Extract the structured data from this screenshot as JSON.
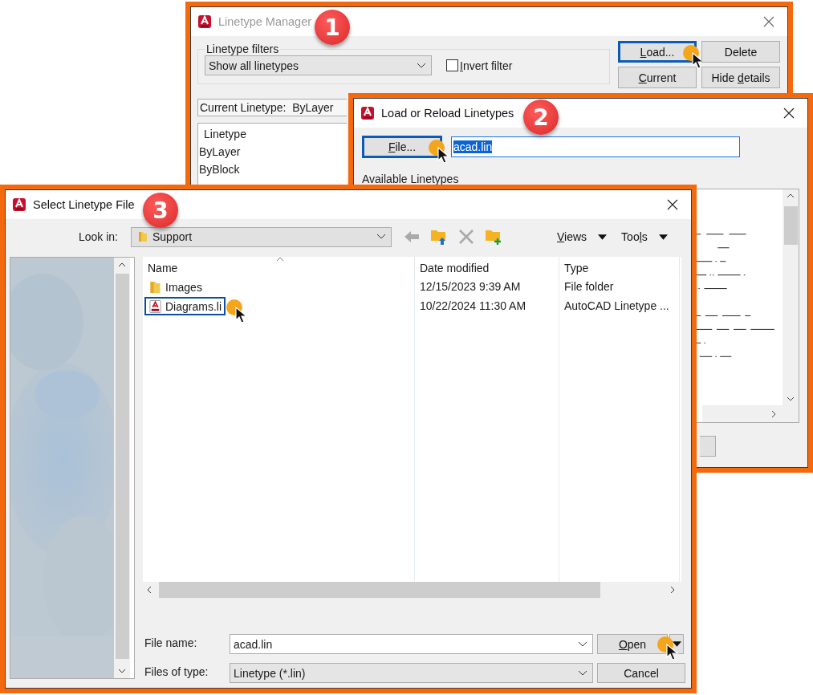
{
  "linetype_manager": {
    "title": "Linetype Manager",
    "active": false,
    "step": "1",
    "filters": {
      "legend": "Linetype filters",
      "combo": "Show all linetypes",
      "invert": {
        "label": "Invert filter",
        "checked": false
      }
    },
    "buttons": [
      {
        "label": "Load...",
        "focused": true,
        "clicked": true
      },
      {
        "label": "Delete",
        "focused": false,
        "clicked": false
      },
      {
        "label": "Current",
        "focused": false,
        "clicked": false
      },
      {
        "label": "Hide details",
        "focused": false,
        "clicked": false
      }
    ],
    "current_linetype": {
      "label": "Current Linetype:",
      "value": "ByLayer"
    },
    "list": {
      "header": "Linetype",
      "items": [
        "ByLayer",
        "ByBlock"
      ]
    }
  },
  "load_dialog": {
    "title": "Load or Reload Linetypes",
    "active": true,
    "step": "2",
    "file_button": {
      "label": "File...",
      "focused": true,
      "clicked": true
    },
    "file_field": {
      "value": "acad.lin",
      "text_selected": true
    },
    "available_label": "Available Linetypes"
  },
  "select_dialog": {
    "title": "Select Linetype File",
    "active": true,
    "step": "3",
    "look_in": {
      "label": "Look in:",
      "folder": "Support"
    },
    "tools": [
      {
        "kind": "back",
        "disabled": true
      },
      {
        "kind": "up",
        "disabled": false
      },
      {
        "kind": "delete",
        "disabled": true
      },
      {
        "kind": "new_folder",
        "disabled": false
      }
    ],
    "menus": [
      {
        "label": "Views"
      },
      {
        "label": "Tools"
      }
    ],
    "columns": [
      "Name",
      "Date modified",
      "Type"
    ],
    "rows": [
      {
        "kind": "folder",
        "name": "Images",
        "date": "12/15/2023 9:39 AM",
        "type": "File folder",
        "selected": false,
        "clicked": false
      },
      {
        "kind": "linetype",
        "name": "Diagrams.li",
        "date": "10/22/2024 11:30 AM",
        "type": "AutoCAD Linetype ...",
        "selected": true,
        "clicked": true
      }
    ],
    "file_name": {
      "label": "File name:",
      "value": "acad.lin"
    },
    "file_type": {
      "label": "Files of type:",
      "value": "Linetype (*.lin)"
    },
    "open_button": {
      "label": "Open",
      "clicked": true
    },
    "cancel_button": {
      "label": "Cancel"
    }
  }
}
